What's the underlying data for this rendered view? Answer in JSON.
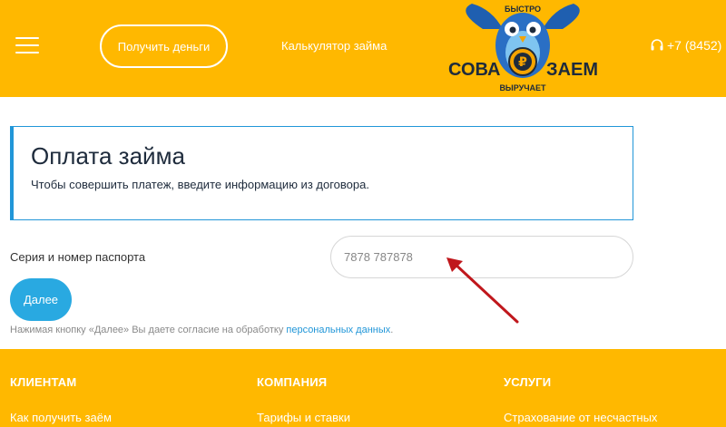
{
  "header": {
    "get_money_label": "Получить деньги",
    "calculator_label": "Калькулятор займа",
    "phone": "+7 (8452)",
    "logo": {
      "top_text": "БЫСТРО",
      "left_text": "СОВА",
      "right_text": "ЗАЕМ",
      "bottom_text": "ВЫРУЧАЕТ",
      "coin_symbol": "₽"
    }
  },
  "info": {
    "title": "Оплата займа",
    "subtitle": "Чтобы совершить платеж, введите информацию из договора."
  },
  "form": {
    "passport_label": "Серия и номер паспорта",
    "passport_value": "7878 787878",
    "next_label": "Далее",
    "consent_text": "Нажимая кнопку «Далее» Вы даете согласие на обработку ",
    "consent_link": "персональных данных",
    "consent_end": "."
  },
  "footer": {
    "columns": [
      {
        "heading": "КЛИЕНТАМ",
        "link": "Как получить заём"
      },
      {
        "heading": "КОМПАНИЯ",
        "link": "Тарифы и ставки"
      },
      {
        "heading": "УСЛУГИ",
        "link": "Страхование от несчастных"
      }
    ]
  },
  "colors": {
    "brand_yellow": "#ffb800",
    "accent_blue": "#29a9e1",
    "arrow_red": "#c0171c"
  }
}
